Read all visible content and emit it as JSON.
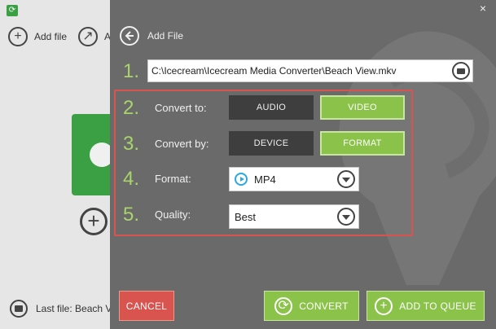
{
  "background_app": {
    "add_file_label": "Add file",
    "second_button_label": "A",
    "last_file_label": "Last file: Beach Vi"
  },
  "dialog": {
    "header_title": "Add File",
    "close_glyph": "×",
    "file_path": "C:\\Icecream\\Icecream Media Converter\\Beach View.mkv",
    "steps": [
      "1.",
      "2.",
      "3.",
      "4.",
      "5."
    ],
    "convert_to": {
      "label": "Convert to:",
      "options": [
        "AUDIO",
        "VIDEO"
      ],
      "selected": "VIDEO"
    },
    "convert_by": {
      "label": "Convert by:",
      "options": [
        "DEVICE",
        "FORMAT"
      ],
      "selected": "FORMAT"
    },
    "format": {
      "label": "Format:",
      "value": "MP4"
    },
    "quality": {
      "label": "Quality:",
      "value": "Best"
    },
    "buttons": {
      "cancel": "CANCEL",
      "convert": "CONVERT",
      "add_to_queue": "ADD TO QUEUE"
    }
  },
  "colors": {
    "accent_green": "#8bc34a",
    "step_number": "#a9d46b",
    "cancel_red": "#d9534f",
    "highlight_border": "#d9534f",
    "panel_bg": "#6a6a6a",
    "dark_toggle": "#3e3e3e",
    "play_icon": "#2aa8e0"
  },
  "icons": {
    "back": "arrow-left-icon",
    "folder": "folder-icon",
    "chevron": "chevron-down-icon",
    "play": "play-icon",
    "convert": "refresh-icon",
    "queue": "plus-icon"
  }
}
